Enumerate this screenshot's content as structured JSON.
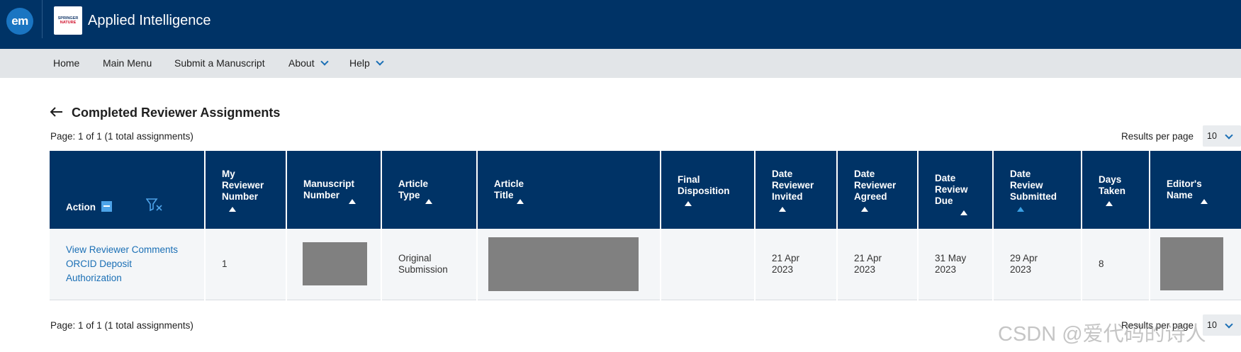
{
  "header": {
    "logo_text": "em",
    "publisher_logo": [
      "SPRINGER",
      "NATURE"
    ],
    "journal_title": "Applied Intelligence"
  },
  "nav": {
    "items": [
      {
        "label": "Home",
        "has_menu": false
      },
      {
        "label": "Main Menu",
        "has_menu": false
      },
      {
        "label": "Submit a Manuscript",
        "has_menu": false
      },
      {
        "label": "About",
        "has_menu": true
      },
      {
        "label": "Help",
        "has_menu": true
      }
    ]
  },
  "page": {
    "title": "Completed Reviewer Assignments",
    "pager_text": "Page: 1 of 1 (1 total assignments)",
    "results_per_page_label": "Results per page",
    "results_per_page_value": "10"
  },
  "table": {
    "columns": [
      {
        "label": "Action"
      },
      {
        "label": "My Reviewer Number"
      },
      {
        "label": "Manuscript Number"
      },
      {
        "label": "Article Type"
      },
      {
        "label": "Article Title"
      },
      {
        "label": "Final Disposition"
      },
      {
        "label": "Date Reviewer Invited"
      },
      {
        "label": "Date Reviewer Agreed"
      },
      {
        "label": "Date Review Due"
      },
      {
        "label": "Date Review Submitted"
      },
      {
        "label": "Days Taken"
      },
      {
        "label": "Editor's Name"
      }
    ],
    "rows": [
      {
        "actions": [
          "View Reviewer Comments",
          "ORCID Deposit",
          "Authorization"
        ],
        "reviewer_number": "1",
        "article_type": "Original Submission",
        "final_disposition": "",
        "date_invited": "21 Apr 2023",
        "date_agreed": "21 Apr 2023",
        "date_due": "31 May 2023",
        "date_submitted": "29 Apr 2023",
        "days_taken": "8"
      }
    ]
  },
  "colors": {
    "header_bg": "#003366",
    "nav_bg": "#e2e5e8",
    "link": "#1a6fb5",
    "active_sort": "#3aa0e4"
  },
  "watermark": "CSDN @爱代码的诗人"
}
